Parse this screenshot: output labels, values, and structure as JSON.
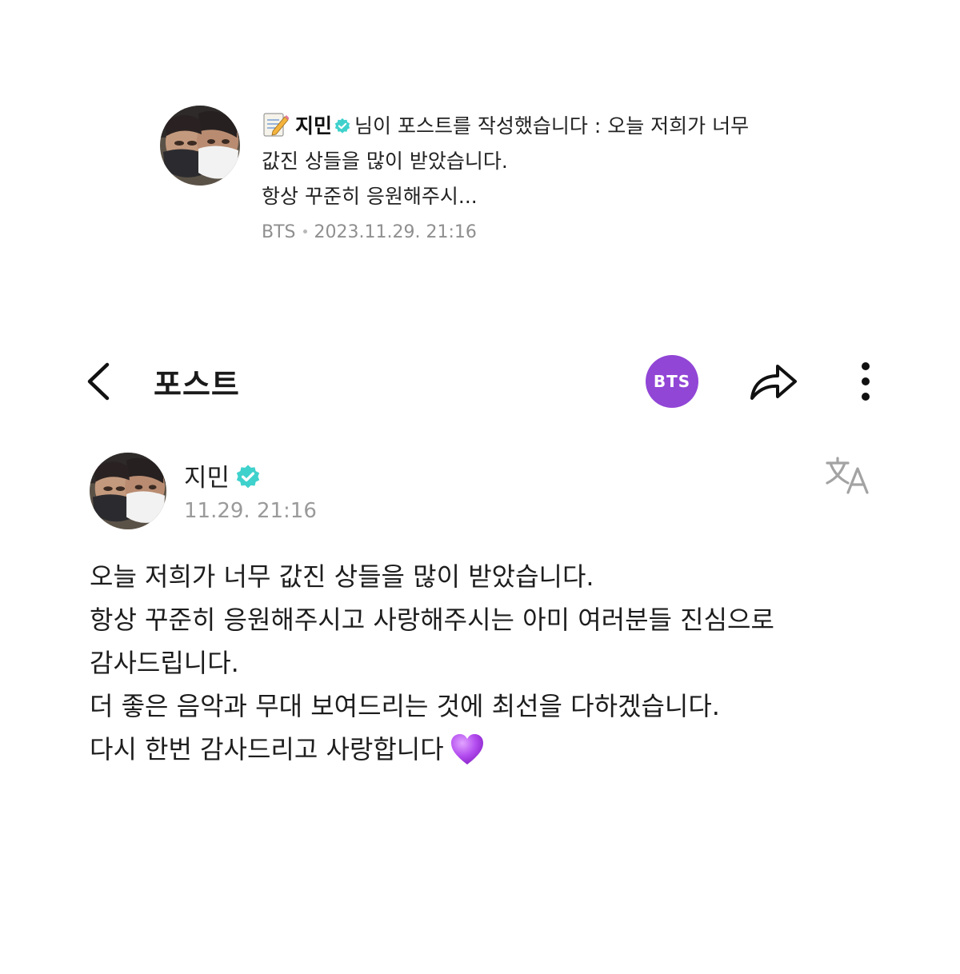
{
  "notification": {
    "memo_icon": "memo-icon",
    "author": "지민",
    "verified_icon": "verified-badge-icon",
    "line1_rest": "님이 포스트를 작성했습니다 : 오늘 저희가 너무",
    "line2": "값진 상들을 많이 받았습니다.",
    "line3": "항상 꾸준히 응원해주시...",
    "source": "BTS",
    "timestamp": "2023.11.29. 21:16"
  },
  "header": {
    "back_icon": "chevron-left-icon",
    "title": "포스트",
    "community_badge": "BTS",
    "share_icon": "share-icon",
    "more_icon": "more-vertical-icon"
  },
  "post": {
    "author": "지민",
    "verified_icon": "verified-badge-icon",
    "time": "11.29. 21:16",
    "translate_icon": "translate-icon",
    "lines": [
      "오늘 저희가 너무 값진 상들을 많이 받았습니다.",
      "항상 꾸준히 응원해주시고 사랑해주시는 아미 여러분들 진심으로",
      "감사드립니다.",
      "더 좋은 음악과 무대 보여드리는 것에 최선을 다하겠습니다.",
      "다시 한번 감사드리고 사랑합니다"
    ],
    "emoji": "purple-heart-icon"
  },
  "colors": {
    "accent_purple": "#9146d6",
    "verified_teal": "#3fd1cc",
    "heart_purple": "#a93ee6",
    "meta_gray": "#8f8f8f"
  }
}
